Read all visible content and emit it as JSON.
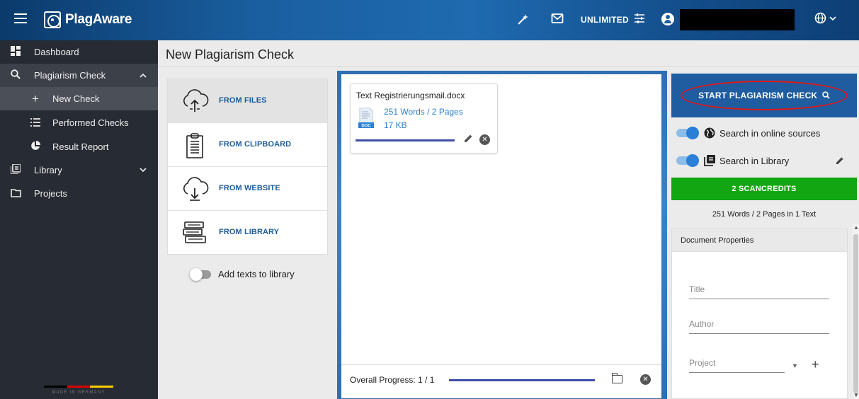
{
  "topbar": {
    "app_name": "PlagAware",
    "unlimited_label": "UNLIMITED",
    "icons": [
      "menu-icon",
      "magic-wand-icon",
      "mail-icon",
      "sliders-icon",
      "user-icon",
      "globe-icon",
      "chevron-down-icon"
    ]
  },
  "sidebar": {
    "items": [
      {
        "label": "Dashboard",
        "icon": "dashboard-icon"
      },
      {
        "label": "Plagiarism Check",
        "icon": "search-icon"
      },
      {
        "label": "New Check",
        "icon": "plus-icon"
      },
      {
        "label": "Performed Checks",
        "icon": "list-icon"
      },
      {
        "label": "Result Report",
        "icon": "pie-chart-icon"
      },
      {
        "label": "Library",
        "icon": "library-icon"
      },
      {
        "label": "Projects",
        "icon": "folder-icon"
      }
    ],
    "made_in": "MADE IN GERMANY"
  },
  "page": {
    "title": "New Plagiarism Check"
  },
  "sources": {
    "items": [
      {
        "label": "FROM FILES",
        "icon": "cloud-upload-icon"
      },
      {
        "label": "FROM CLIPBOARD",
        "icon": "clipboard-icon"
      },
      {
        "label": "FROM WEBSITE",
        "icon": "cloud-download-icon"
      },
      {
        "label": "FROM LIBRARY",
        "icon": "books-icon"
      }
    ],
    "add_to_library_label": "Add texts to library"
  },
  "file": {
    "name": "Text Registrierungsmail.docx",
    "words_pages": "251 Words / 2 Pages",
    "size": "17 KB",
    "badge": "DOC"
  },
  "progress": {
    "label": "Overall Progress: 1 / 1"
  },
  "right": {
    "start_label": "START PLAGIARISM CHECK",
    "online_label": "Search in online sources",
    "library_label": "Search in Library",
    "credits_label": "2 SCANCREDITS",
    "summary": "251 Words / 2 Pages in 1 Text",
    "props_title": "Document Properties",
    "title_placeholder": "Title",
    "author_placeholder": "Author",
    "project_placeholder": "Project"
  },
  "colors": {
    "topbar": "#1a5fa0",
    "sidebar": "#272b33",
    "accent_blue": "#1f5ca0",
    "credits_green": "#12a612",
    "highlight_red": "#e01a1a"
  }
}
